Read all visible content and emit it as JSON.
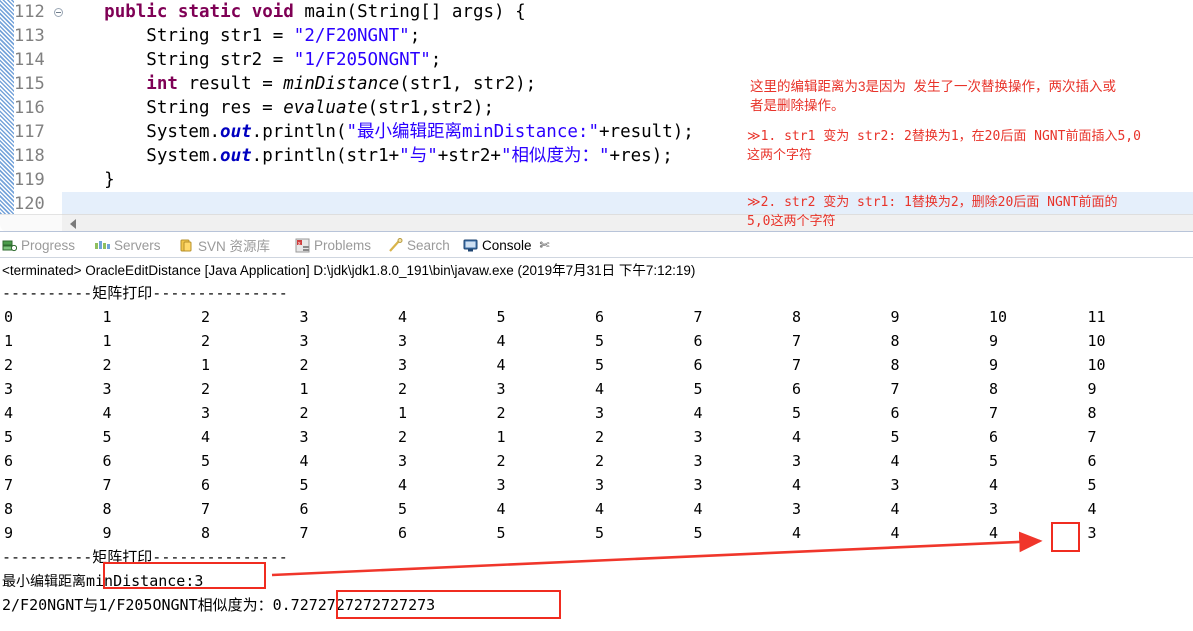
{
  "editor": {
    "lines": [
      {
        "num": "112",
        "folded": true,
        "segments": [
          {
            "t": "    ",
            "c": "pln"
          },
          {
            "t": "public ",
            "c": "kw"
          },
          {
            "t": "static ",
            "c": "kw"
          },
          {
            "t": "void ",
            "c": "kw"
          },
          {
            "t": "main",
            "c": "pln"
          },
          {
            "t": "(String[] args) {",
            "c": "pln"
          }
        ]
      },
      {
        "num": "113",
        "folded": false,
        "segments": [
          {
            "t": "        String str1 = ",
            "c": "pln"
          },
          {
            "t": "\"2/F20NGNT\"",
            "c": "str"
          },
          {
            "t": ";",
            "c": "pln"
          }
        ]
      },
      {
        "num": "114",
        "folded": false,
        "segments": [
          {
            "t": "        String str2 = ",
            "c": "pln"
          },
          {
            "t": "\"1/F205ONGNT\"",
            "c": "str"
          },
          {
            "t": ";",
            "c": "pln"
          }
        ]
      },
      {
        "num": "115",
        "folded": false,
        "segments": [
          {
            "t": "        ",
            "c": "pln"
          },
          {
            "t": "int ",
            "c": "kw"
          },
          {
            "t": "result = ",
            "c": "pln"
          },
          {
            "t": "minDistance",
            "c": "mth"
          },
          {
            "t": "(str1, str2);",
            "c": "pln"
          }
        ]
      },
      {
        "num": "116",
        "folded": false,
        "segments": [
          {
            "t": "        String res = ",
            "c": "pln"
          },
          {
            "t": "evaluate",
            "c": "mth"
          },
          {
            "t": "(str1,str2);",
            "c": "pln"
          }
        ]
      },
      {
        "num": "117",
        "folded": false,
        "segments": [
          {
            "t": "        System.",
            "c": "pln"
          },
          {
            "t": "out",
            "c": "fld"
          },
          {
            "t": ".println(",
            "c": "pln"
          },
          {
            "t": "\"最小编辑距离minDistance:\"",
            "c": "str"
          },
          {
            "t": "+result);",
            "c": "pln"
          }
        ]
      },
      {
        "num": "118",
        "folded": false,
        "segments": [
          {
            "t": "        System.",
            "c": "pln"
          },
          {
            "t": "out",
            "c": "fld"
          },
          {
            "t": ".println(str1+",
            "c": "pln"
          },
          {
            "t": "\"与\"",
            "c": "str"
          },
          {
            "t": "+str2+",
            "c": "pln"
          },
          {
            "t": "\"相似度为：\"",
            "c": "str"
          },
          {
            "t": "+res);",
            "c": "pln"
          }
        ]
      },
      {
        "num": "119",
        "folded": false,
        "segments": [
          {
            "t": "    }",
            "c": "pln"
          }
        ]
      },
      {
        "num": "120",
        "folded": false,
        "segments": [
          {
            "t": "",
            "c": "pln"
          }
        ]
      }
    ]
  },
  "annotations": {
    "note1": "这里的编辑距离为3是因为  发生了一次替换操作，两次插入或\n者是删除操作。",
    "note2": "≫1. str1 变为 str2: 2替换为1，在20后面 NGNT前面插入5,0\n这两个字符",
    "note3": "≫2. str2 变为 str1: 1替换为2，删除20后面 NGNT前面的\n5,0这两个字符",
    "arrow_color": "#f02c20"
  },
  "console": {
    "tabs": [
      {
        "label": "Progress",
        "icon": "progress-icon",
        "active": false
      },
      {
        "label": "Servers",
        "icon": "servers-icon",
        "active": false
      },
      {
        "label": "SVN 资源库",
        "icon": "svn-repo-icon",
        "active": false
      },
      {
        "label": "Problems",
        "icon": "problems-icon",
        "active": false
      },
      {
        "label": "Search",
        "icon": "search-icon",
        "active": false
      },
      {
        "label": "Console",
        "icon": "console-icon",
        "active": true
      }
    ],
    "close_glyph": "✄",
    "terminated_line": "<terminated> OracleEditDistance [Java Application] D:\\jdk\\jdk1.8.0_191\\bin\\javaw.exe (2019年7月31日 下午7:12:19)"
  },
  "output": {
    "separator_top": "----------矩阵打印---------------",
    "separator_bottom": "----------矩阵打印---------------",
    "matrix": [
      [
        0,
        1,
        2,
        3,
        4,
        5,
        6,
        7,
        8,
        9,
        10,
        11
      ],
      [
        1,
        1,
        2,
        3,
        3,
        4,
        5,
        6,
        7,
        8,
        9,
        10
      ],
      [
        2,
        2,
        1,
        2,
        3,
        4,
        5,
        6,
        7,
        8,
        9,
        10
      ],
      [
        3,
        3,
        2,
        1,
        2,
        3,
        4,
        5,
        6,
        7,
        8,
        9
      ],
      [
        4,
        4,
        3,
        2,
        1,
        2,
        3,
        4,
        5,
        6,
        7,
        8
      ],
      [
        5,
        5,
        4,
        3,
        2,
        1,
        2,
        3,
        4,
        5,
        6,
        7
      ],
      [
        6,
        6,
        5,
        4,
        3,
        2,
        2,
        3,
        3,
        4,
        5,
        6
      ],
      [
        7,
        7,
        6,
        5,
        4,
        3,
        3,
        3,
        4,
        3,
        4,
        5
      ],
      [
        8,
        8,
        7,
        6,
        5,
        4,
        4,
        4,
        3,
        4,
        3,
        4
      ],
      [
        9,
        9,
        8,
        7,
        6,
        5,
        5,
        5,
        4,
        4,
        4,
        3
      ]
    ],
    "min_distance_prefix": "最小编辑距离",
    "min_distance_box": "minDistance:3",
    "similarity_prefix": "2/F20NGNT与1/F205ONGNT相似度为：",
    "similarity_value": "0.7272727272727273"
  },
  "chart_data": {
    "type": "table",
    "title": "矩阵打印 (Edit distance DP matrix)",
    "rows": 10,
    "cols": 12,
    "values": [
      [
        0,
        1,
        2,
        3,
        4,
        5,
        6,
        7,
        8,
        9,
        10,
        11
      ],
      [
        1,
        1,
        2,
        3,
        3,
        4,
        5,
        6,
        7,
        8,
        9,
        10
      ],
      [
        2,
        2,
        1,
        2,
        3,
        4,
        5,
        6,
        7,
        8,
        9,
        10
      ],
      [
        3,
        3,
        2,
        1,
        2,
        3,
        4,
        5,
        6,
        7,
        8,
        9
      ],
      [
        4,
        4,
        3,
        2,
        1,
        2,
        3,
        4,
        5,
        6,
        7,
        8
      ],
      [
        5,
        5,
        4,
        3,
        2,
        1,
        2,
        3,
        4,
        5,
        6,
        7
      ],
      [
        6,
        6,
        5,
        4,
        3,
        2,
        2,
        3,
        3,
        4,
        5,
        6
      ],
      [
        7,
        7,
        6,
        5,
        4,
        3,
        3,
        3,
        4,
        3,
        4,
        5
      ],
      [
        8,
        8,
        7,
        6,
        5,
        4,
        4,
        4,
        3,
        4,
        3,
        4
      ],
      [
        9,
        9,
        8,
        7,
        6,
        5,
        5,
        5,
        4,
        4,
        4,
        3
      ]
    ],
    "highlighted_cell": {
      "row": 9,
      "col": 11,
      "value": 3
    }
  }
}
